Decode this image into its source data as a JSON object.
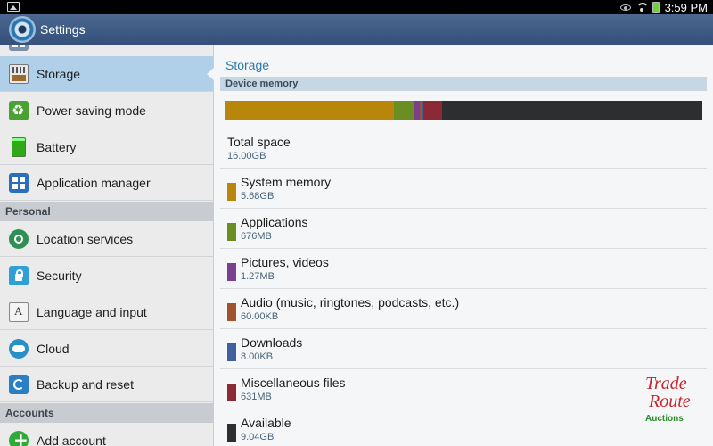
{
  "status_bar": {
    "time": "3:59 PM",
    "icons": [
      "notification-image-icon",
      "eye-icon",
      "wifi-icon",
      "battery-icon"
    ]
  },
  "action_bar": {
    "title": "Settings",
    "icon": "settings-gear-icon"
  },
  "sidebar": {
    "items": [
      {
        "label": "Storage",
        "icon": "storage-icon",
        "active": true
      },
      {
        "label": "Power saving mode",
        "icon": "power-saving-icon"
      },
      {
        "label": "Battery",
        "icon": "battery-icon"
      },
      {
        "label": "Application manager",
        "icon": "apps-grid-icon"
      }
    ],
    "section_personal": "Personal",
    "personal_items": [
      {
        "label": "Location services",
        "icon": "location-icon"
      },
      {
        "label": "Security",
        "icon": "lock-icon"
      },
      {
        "label": "Language and input",
        "icon": "language-icon"
      },
      {
        "label": "Cloud",
        "icon": "cloud-icon"
      },
      {
        "label": "Backup and reset",
        "icon": "backup-icon"
      }
    ],
    "section_accounts": "Accounts",
    "accounts_items": [
      {
        "label": "Add account",
        "icon": "add-icon"
      }
    ]
  },
  "main": {
    "title": "Storage",
    "section_header": "Device memory",
    "usage_bar": {
      "segments": [
        {
          "name": "System memory",
          "fraction": 0.355,
          "color": "#b8860b"
        },
        {
          "name": "Applications",
          "fraction": 0.041,
          "color": "#6b8e23"
        },
        {
          "name": "Pictures, videos",
          "fraction": 0.012,
          "color": "#7b3f8f"
        },
        {
          "name": "Audio",
          "fraction": 0.004,
          "color": "#a0522d"
        },
        {
          "name": "Downloads",
          "fraction": 0.004,
          "color": "#3f5f9f"
        },
        {
          "name": "Miscellaneous files",
          "fraction": 0.039,
          "color": "#8b2a35"
        }
      ],
      "track_color": "#2d2e30"
    },
    "total": {
      "label": "Total space",
      "value": "16.00GB"
    },
    "rows": [
      {
        "label": "System memory",
        "value": "5.68GB",
        "color": "#b8860b"
      },
      {
        "label": "Applications",
        "value": "676MB",
        "color": "#6b8e23"
      },
      {
        "label": "Pictures, videos",
        "value": "1.27MB",
        "color": "#7b3f8f"
      },
      {
        "label": "Audio (music, ringtones, podcasts, etc.)",
        "value": "60.00KB",
        "color": "#a0522d"
      },
      {
        "label": "Downloads",
        "value": "8.00KB",
        "color": "#3f5f9f"
      },
      {
        "label": "Miscellaneous files",
        "value": "631MB",
        "color": "#8b2a35"
      },
      {
        "label": "Available",
        "value": "9.04GB",
        "color": "#2d2e30"
      }
    ]
  },
  "watermark": {
    "line1": "Trade",
    "line2": "Route",
    "line3": "Auctions"
  }
}
